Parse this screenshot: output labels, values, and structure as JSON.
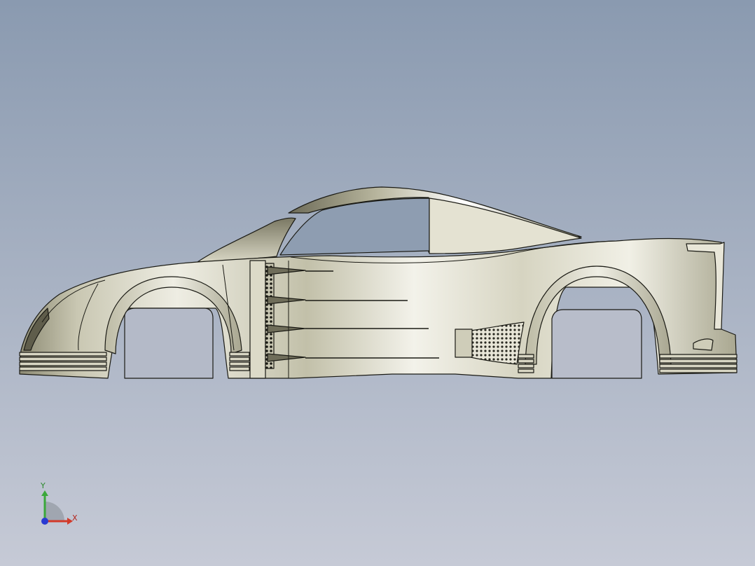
{
  "viewport": {
    "background_top": "#8a9ab0",
    "background_bottom": "#c6cad6"
  },
  "model": {
    "body_color": "#d3d1c0",
    "highlight_color": "#f7f6ee",
    "shade_color": "#6e6c5a",
    "edge_color": "#1a1a14"
  },
  "triad": {
    "x_label": "X",
    "y_label": "Y",
    "x_color": "#d23a2a",
    "y_color": "#3aa83a",
    "z_color": "#2a3ad2"
  }
}
